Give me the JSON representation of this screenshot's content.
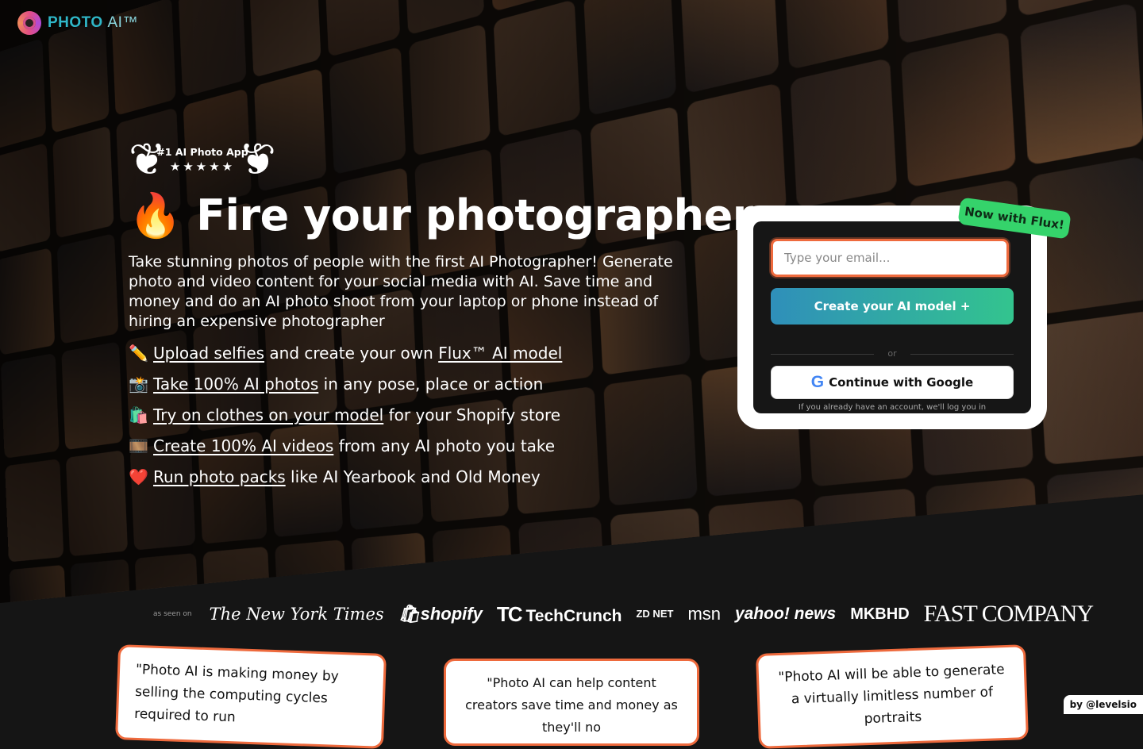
{
  "brand": {
    "name": "PHOTO",
    "suffix": "AI™"
  },
  "award": {
    "title": "#1 AI Photo App",
    "stars": "★★★★★",
    "rating": 5
  },
  "hero": {
    "headline_emoji": "🔥",
    "headline": "Fire your photographer",
    "lead": "Take stunning photos of people with the first AI Photographer! Generate photo and video content for your social media with AI. Save time and money and do an AI photo shoot from your laptop or phone instead of hiring an expensive photographer"
  },
  "features": [
    {
      "emoji": "✏️",
      "link": "Upload selfies",
      "mid": " and create your own ",
      "link2": "Flux™ AI model",
      "rest": ""
    },
    {
      "emoji": "📸",
      "link": "Take 100% AI photos",
      "rest": " in any pose, place or action"
    },
    {
      "emoji": "🛍️",
      "link": "Try on clothes on your model",
      "rest": " for your Shopify store"
    },
    {
      "emoji": "🎞️",
      "link": "Create 100% AI videos",
      "rest": " from any AI photo you take"
    },
    {
      "emoji": "❤️",
      "link": "Run photo packs",
      "rest": " like AI Yearbook and Old Money"
    }
  ],
  "signup": {
    "badge": "Now with Flux!",
    "email_placeholder": "Type your email...",
    "email_value": "",
    "create_label": "Create your AI model +",
    "or_label": "or",
    "google_label": "Continue with Google",
    "note": "If you already have an account, we'll log you in"
  },
  "press": {
    "label": "as seen on",
    "logos": [
      "The New York Times",
      "shopify",
      "TechCrunch",
      "ZD NET",
      "msn",
      "yahoo! news",
      "MKBHD",
      "FAST COMPANY"
    ]
  },
  "testimonials": [
    {
      "text": "\"Photo AI is making money by selling the computing cycles required to run"
    },
    {
      "text": "\"Photo AI can help content creators save time and money as they'll no"
    },
    {
      "text": "\"Photo AI will be able to generate a virtually limitless number of portraits"
    }
  ],
  "footer": {
    "by": "by @levelsio"
  },
  "colors": {
    "accent_orange": "#ee6a3d",
    "badge_green": "#35d36b",
    "cta_start": "#2f8fba",
    "cta_end": "#33c48e",
    "logo_teal": "#2fb7c8"
  }
}
